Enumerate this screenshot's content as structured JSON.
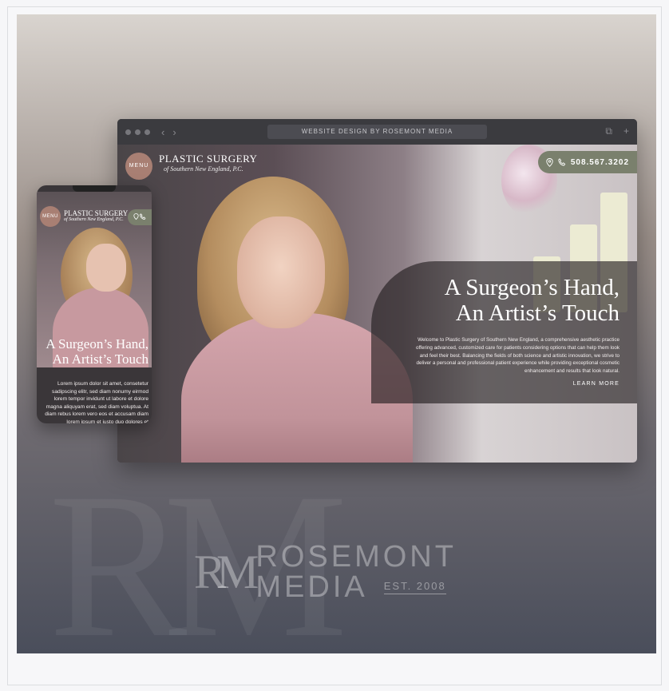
{
  "watermark": {
    "monogram": "RM"
  },
  "brand": {
    "monogram": "RM",
    "line1": "ROSEMONT",
    "line2": "MEDIA",
    "est": "EST. 2008"
  },
  "browser": {
    "url_label": "WEBSITE DESIGN BY ROSEMONT MEDIA",
    "nav_back": "‹",
    "nav_forward": "›",
    "copy_icon": "⧉",
    "new_tab_icon": "+"
  },
  "site": {
    "menu_label": "MENU",
    "logo_title": "PLASTIC SURGERY",
    "logo_subtitle": "of Southern New England, P.C.",
    "phone": "508.567.3202",
    "headline_line1": "A Surgeon’s Hand,",
    "headline_line2": "An Artist’s Touch",
    "body": "Welcome to Plastic Surgery of Southern New England, a comprehensive aesthetic practice offering advanced, customized care for patients considering options that can help them look and feel their best. Balancing the fields of both science and artistic innovation, we strive to deliver a personal and professional patient experience while providing exceptional cosmetic enhancement and results that look natural.",
    "cta": "LEARN MORE"
  },
  "mobile": {
    "menu_label": "MENU",
    "logo_title": "PLASTIC SURGERY",
    "logo_subtitle": "of Southern New England, P.C.",
    "headline_line1": "A Surgeon’s Hand,",
    "headline_line2": "An Artist’s Touch",
    "body": "Lorem ipsum dolor sit amet, consetetur sadipscing elitr, sed diam nonumy eirmod lorem tempor invidunt ut labore et dolore magna aliquyam erat, sed diam voluptua. At diam rebus lorem vero eos et accusam diam lorem ipsum et justo duo dolores et"
  },
  "colors": {
    "menu_circle": "#a87f73",
    "phone_pill": "#7a806d",
    "panel": "#1e1a1c"
  },
  "icons": [
    "location-pin-icon",
    "phone-icon",
    "copy-icon",
    "plus-icon",
    "chevron-left-icon",
    "chevron-right-icon"
  ]
}
